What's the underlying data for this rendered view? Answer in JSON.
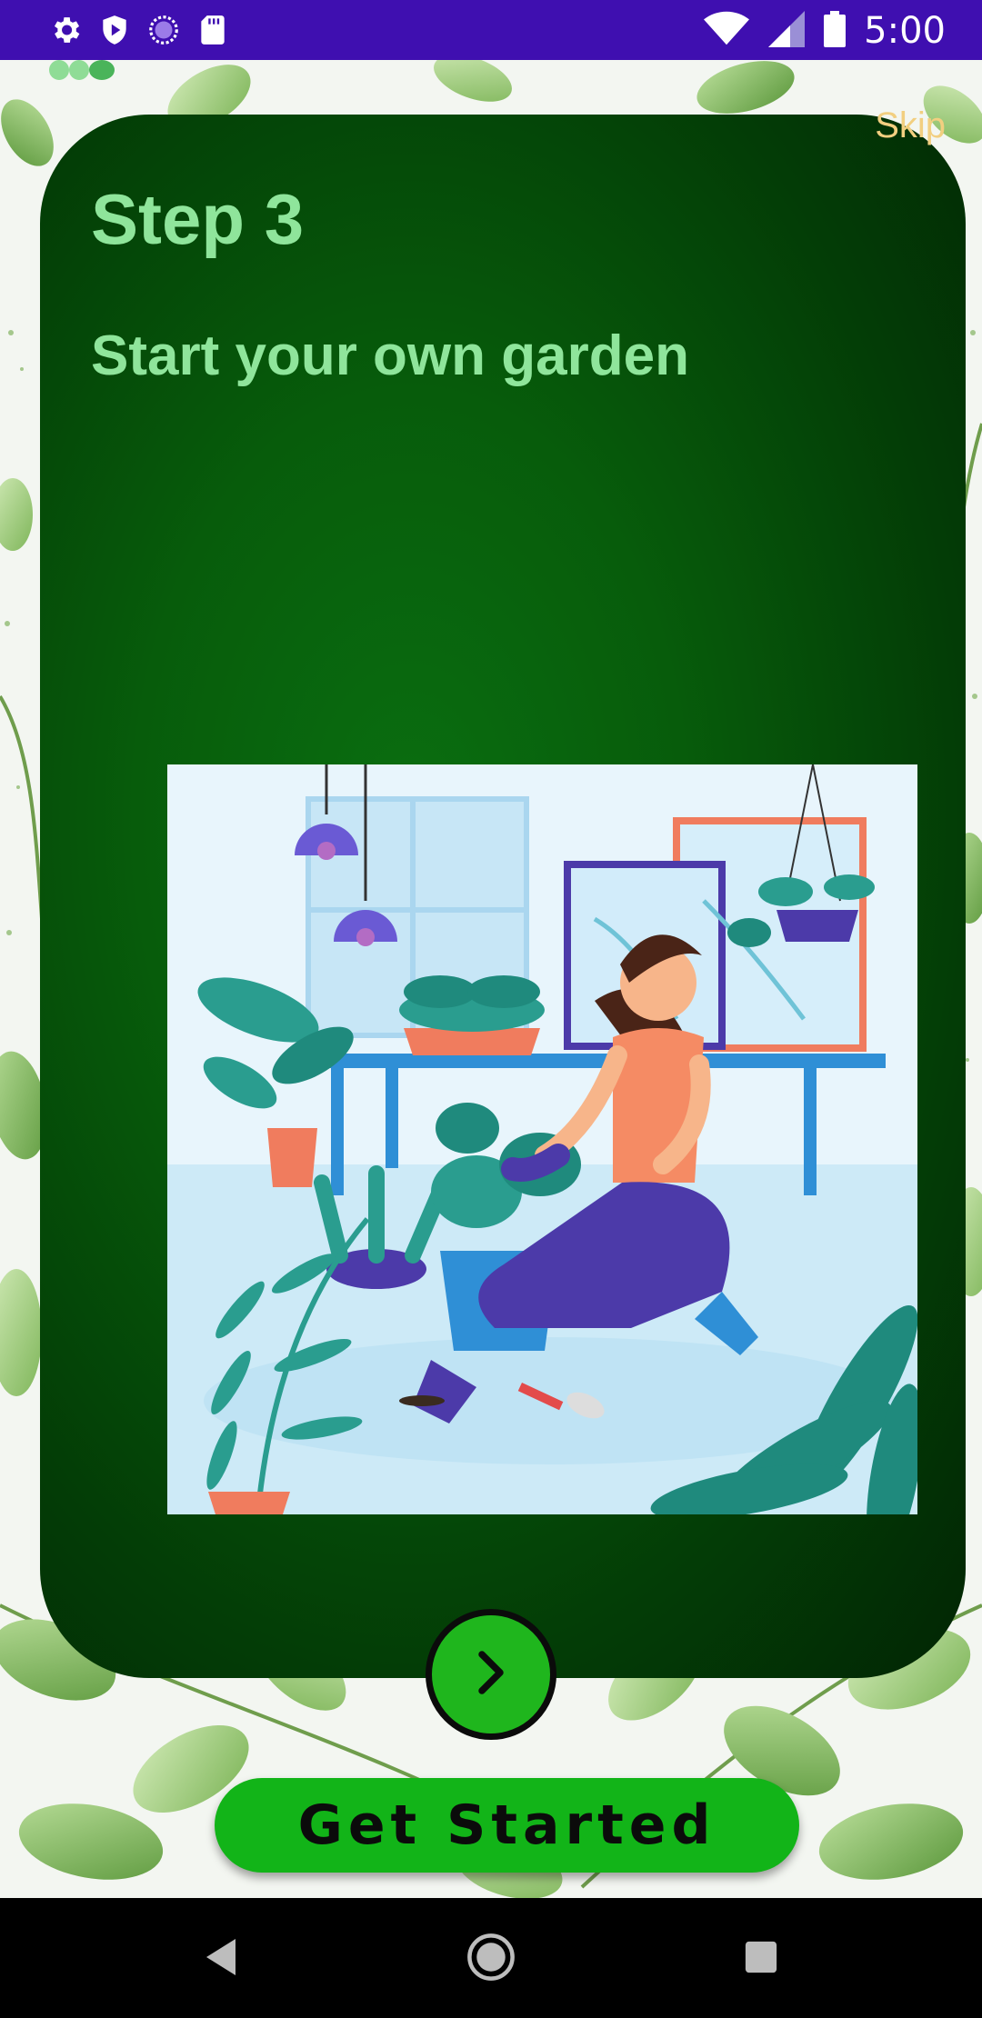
{
  "status_bar": {
    "time": "5:00",
    "left_icons": [
      "settings-icon",
      "shield-play-icon",
      "spinner-icon",
      "sd-card-icon"
    ],
    "right_icons": [
      "wifi-icon",
      "signal-icon",
      "battery-icon"
    ]
  },
  "page_indicator": {
    "count": 3,
    "active_index": 2
  },
  "onboarding": {
    "skip_label": "Skip",
    "step_title": "Step 3",
    "step_subtitle": "Start your own garden",
    "illustration": "woman-gardening-illustration"
  },
  "actions": {
    "next_icon": "chevron-right-icon",
    "get_started_label": "Get Started"
  },
  "nav_bar": {
    "buttons": [
      "back-icon",
      "home-icon",
      "recents-icon"
    ]
  },
  "colors": {
    "status_bar": "#3f0fb0",
    "card_dark": "#022504",
    "card_center": "#0a6e10",
    "title_text": "#8fe59b",
    "skip_text": "#f2cf80",
    "button_green": "#12b418",
    "nav_bar": "#000000"
  }
}
